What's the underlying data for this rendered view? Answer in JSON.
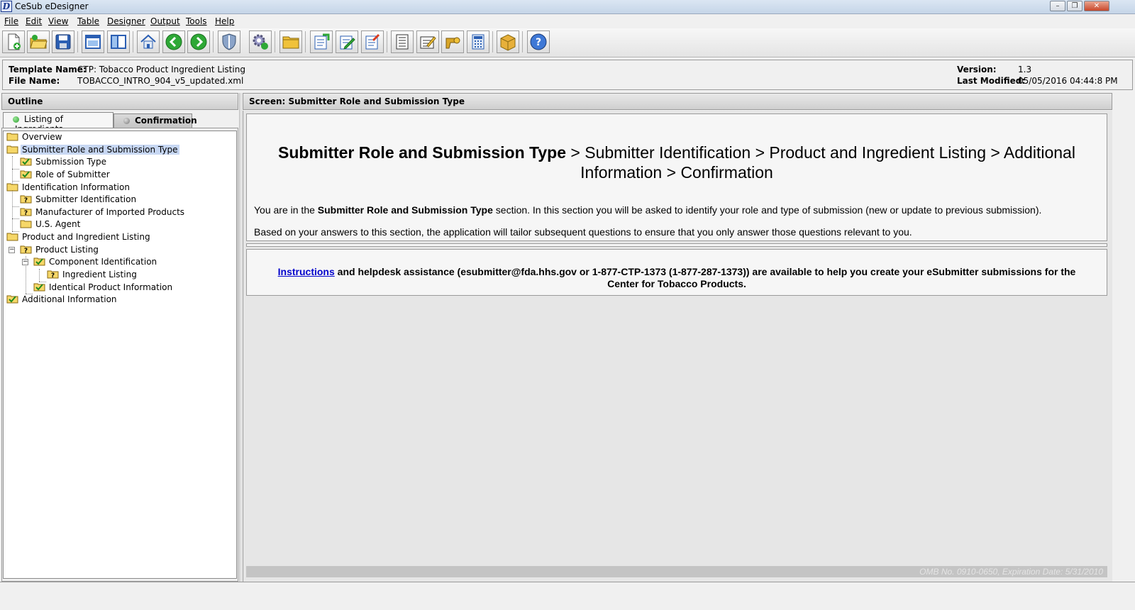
{
  "window": {
    "app_icon_letter": "D",
    "title": "CeSub eDesigner",
    "controls": [
      "minimize-icon",
      "restore-icon",
      "close-icon"
    ]
  },
  "menu": [
    {
      "label": "File"
    },
    {
      "label": "Edit"
    },
    {
      "label": "View"
    },
    {
      "label": "Table"
    },
    {
      "label": "Designer"
    },
    {
      "label": "Output"
    },
    {
      "label": "Tools"
    },
    {
      "label": "Help"
    }
  ],
  "toolbar": {
    "buttons": [
      "new-document-icon",
      "open-folder-icon",
      "save-icon",
      "window-icon",
      "split-panel-icon",
      "home-icon",
      "back-arrow-icon",
      "forward-arrow-icon",
      "shield-icon",
      "settings-gear-icon",
      "folder-icon",
      "export-icon",
      "edit-icon",
      "import-icon",
      "list-document-icon",
      "form-edit-icon",
      "key-icon",
      "calculator-icon",
      "package-icon",
      "help-icon"
    ]
  },
  "info": {
    "template_label": "Template Name:",
    "template_value": "CTP: Tobacco Product Ingredient Listing",
    "file_label": "File Name:",
    "file_value": "TOBACCO_INTRO_904_v5_updated.xml",
    "version_label": "Version:",
    "version_value": "1.3",
    "modified_label": "Last Modified:",
    "modified_value": "05/05/2016 04:44:8 PM"
  },
  "outline": {
    "header": "Outline",
    "tabs": [
      {
        "label": "Listing of Ingredients",
        "status": "green"
      },
      {
        "label": "Confirmation",
        "status": "gray"
      }
    ],
    "tree": [
      {
        "label": "Overview",
        "icon": "folder-icon",
        "level": 0
      },
      {
        "label": "Submitter Role and Submission Type",
        "icon": "folder-icon",
        "level": 0,
        "selected": true
      },
      {
        "label": "Submission Type",
        "icon": "checked-folder-icon",
        "level": 1
      },
      {
        "label": "Role of Submitter",
        "icon": "checked-folder-icon",
        "level": 1
      },
      {
        "label": "Identification Information",
        "icon": "folder-icon",
        "level": 0
      },
      {
        "label": "Submitter Identification",
        "icon": "question-folder-icon",
        "level": 1
      },
      {
        "label": "Manufacturer of Imported Products",
        "icon": "question-folder-icon",
        "level": 1
      },
      {
        "label": "U.S. Agent",
        "icon": "folder-icon",
        "level": 1
      },
      {
        "label": "Product and Ingredient Listing",
        "icon": "folder-icon",
        "level": 0
      },
      {
        "label": "Product Listing",
        "icon": "question-folder-icon",
        "level": 1,
        "expanded": true
      },
      {
        "label": "Component Identification",
        "icon": "checked-folder-icon",
        "level": 2,
        "expanded": true
      },
      {
        "label": "Ingredient Listing",
        "icon": "question-folder-icon",
        "level": 3
      },
      {
        "label": "Identical Product Information",
        "icon": "checked-folder-icon",
        "level": 2
      },
      {
        "label": "Additional Information",
        "icon": "checked-folder-icon",
        "level": 0
      }
    ]
  },
  "screen": {
    "header": "Screen: Submitter Role and Submission Type",
    "breadcrumb_current": "Submitter Role and Submission Type",
    "breadcrumb_rest_1": " > Submitter Identification > Product and Ingredient Listing > Additional",
    "breadcrumb_rest_2": "Information > Confirmation",
    "para1_pre": "You are in the ",
    "para1_bold": "Submitter Role and Submission Type",
    "para1_post": " section. In this section you will be asked to identify your role and type of submission (new or update to previous submission).",
    "para2": "Based on your answers to this section, the application will tailor subsequent questions to ensure that you only answer those questions relevant to you.",
    "help_link": "Instructions",
    "help_text_1": " and helpdesk assistance (esubmitter@fda.hhs.gov or 1-877-CTP-1373 (1-877-287-1373)) are available to help you create your eSubmitter submissions for the",
    "help_text_2": "Center for Tobacco Products.",
    "omb": "OMB No. 0910-0650, Expiration Date: 5/31/2010"
  }
}
